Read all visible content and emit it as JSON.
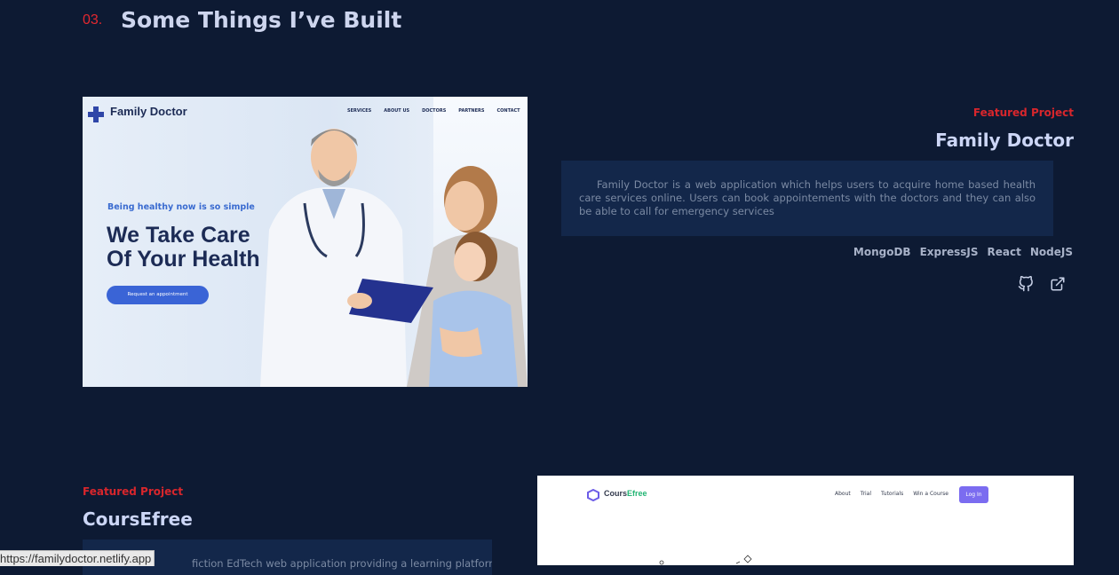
{
  "section": {
    "number": "03.",
    "title": "Some Things I’ve Built"
  },
  "projects": [
    {
      "label": "Featured Project",
      "title": "Family Doctor",
      "description": "Family Doctor is a web application which helps users to acquire home based health care services online. Users can book appointements with the doctors and they can also be able to call for emergency services",
      "tech": [
        "MongoDB",
        "ExpressJS",
        "React",
        "NodeJS"
      ],
      "screenshot": {
        "brand": "Family Doctor",
        "nav": [
          "SERVICES",
          "ABOUT US",
          "DOCTORS",
          "PARTNERS",
          "CONTACT"
        ],
        "tagline": "Being healthy now is so simple",
        "headline1": "We Take Care",
        "headline2": "Of Your Health",
        "cta": "Request an appointment"
      }
    },
    {
      "label": "Featured Project",
      "title": "CoursEfree",
      "description_partial": "fiction EdTech web application providing a learning platform",
      "screenshot": {
        "brand_a": "Cours",
        "brand_b": "Efree",
        "nav": [
          "About",
          "Trial",
          "Tutorials",
          "Win a Course"
        ],
        "login": "Log In"
      }
    }
  ],
  "status_url": "https://familydoctor.netlify.app",
  "colors": {
    "bg": "#0d1a33",
    "accent": "#d8262c",
    "card": "#13274a"
  }
}
